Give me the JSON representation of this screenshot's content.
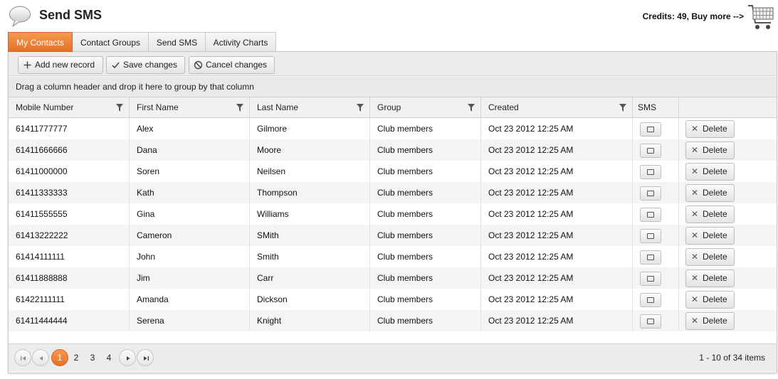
{
  "app": {
    "title": "Send SMS",
    "credits_text": "Credits: 49, Buy more -->",
    "logo_icon": "speech-bubble-icon",
    "cart_icon": "shopping-cart-icon"
  },
  "tabs": [
    {
      "label": "My Contacts",
      "active": true
    },
    {
      "label": "Contact Groups",
      "active": false
    },
    {
      "label": "Send SMS",
      "active": false
    },
    {
      "label": "Activity Charts",
      "active": false
    }
  ],
  "toolbar": {
    "add_label": "Add new record",
    "save_label": "Save changes",
    "cancel_label": "Cancel changes"
  },
  "group_hint": "Drag a column header and drop it here to group by that column",
  "columns": [
    "Mobile Number",
    "First Name",
    "Last Name",
    "Group",
    "Created",
    "SMS",
    ""
  ],
  "rows": [
    {
      "mobile": "61411777777",
      "first": "Alex",
      "last": "Gilmore",
      "group": "Club members",
      "created": "Oct 23 2012 12:25 AM"
    },
    {
      "mobile": "61411666666",
      "first": "Dana",
      "last": "Moore",
      "group": "Club members",
      "created": "Oct 23 2012 12:25 AM"
    },
    {
      "mobile": "61411000000",
      "first": "Soren",
      "last": "Neilsen",
      "group": "Club members",
      "created": "Oct 23 2012 12:25 AM"
    },
    {
      "mobile": "61411333333",
      "first": "Kath",
      "last": "Thompson",
      "group": "Club members",
      "created": "Oct 23 2012 12:25 AM"
    },
    {
      "mobile": "61411555555",
      "first": "Gina",
      "last": "Williams",
      "group": "Club members",
      "created": "Oct 23 2012 12:25 AM"
    },
    {
      "mobile": "61413222222",
      "first": "Cameron",
      "last": "SMith",
      "group": "Club members",
      "created": "Oct 23 2012 12:25 AM"
    },
    {
      "mobile": "61414111111",
      "first": "John",
      "last": "Smith",
      "group": "Club members",
      "created": "Oct 23 2012 12:25 AM"
    },
    {
      "mobile": "61411888888",
      "first": "Jim",
      "last": "Carr",
      "group": "Club members",
      "created": "Oct 23 2012 12:25 AM"
    },
    {
      "mobile": "61422111111",
      "first": "Amanda",
      "last": "Dickson",
      "group": "Club members",
      "created": "Oct 23 2012 12:25 AM"
    },
    {
      "mobile": "61411444444",
      "first": "Serena",
      "last": "Knight",
      "group": "Club members",
      "created": "Oct 23 2012 12:25 AM"
    }
  ],
  "delete_label": "Delete",
  "pager": {
    "pages": [
      "1",
      "2",
      "3",
      "4"
    ],
    "current": "1",
    "info": "1 - 10 of 34 items"
  },
  "colors": {
    "accent": "#e97a33",
    "accent_light": "#f79a4e"
  }
}
